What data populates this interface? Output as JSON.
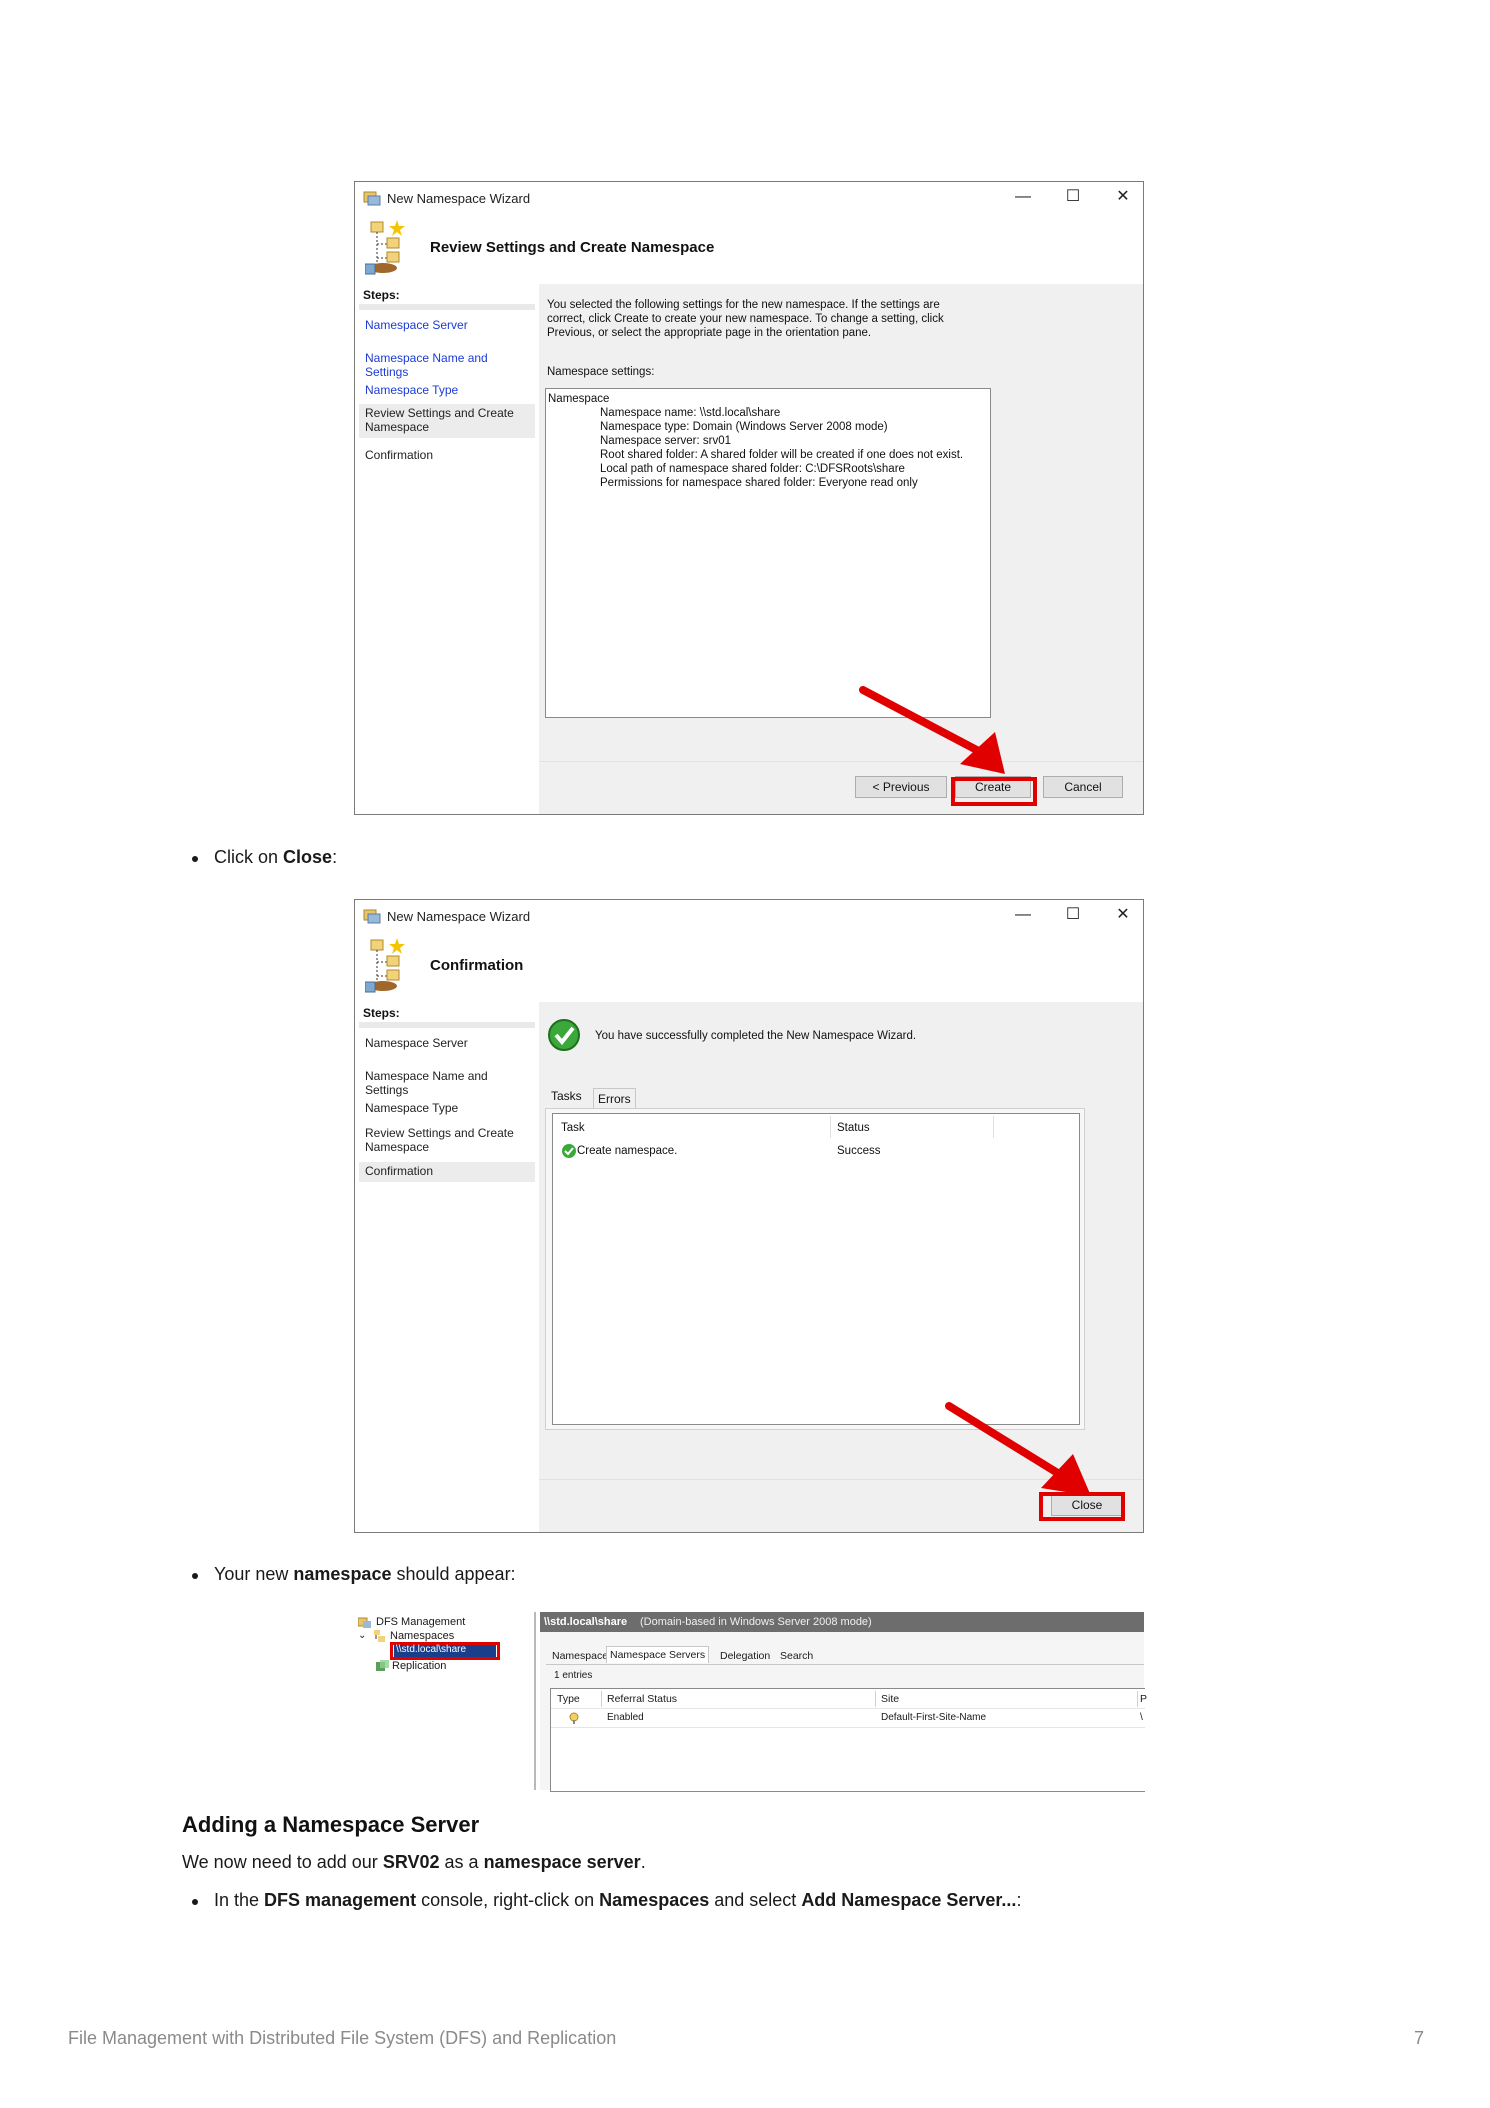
{
  "wizard1": {
    "title": "New Namespace Wizard",
    "header": "Review Settings and Create Namespace",
    "steps_label": "Steps:",
    "steps": [
      "Namespace Server",
      "Namespace Name and Settings",
      "Namespace Type",
      "Review Settings and Create Namespace",
      "Confirmation"
    ],
    "intro": "You selected the following settings for the new namespace. If the settings are correct, click Create to create your new namespace. To change a setting, click Previous, or select the appropriate page in the orientation pane.",
    "settings_label": "Namespace settings:",
    "settings_heading": "Namespace",
    "settings_lines": [
      "Namespace name: \\\\std.local\\share",
      "Namespace type:  Domain (Windows Server 2008 mode)",
      "Namespace server: srv01",
      "Root shared folder:  A shared folder will be created if one does not exist.",
      "Local path of namespace shared folder: C:\\DFSRoots\\share",
      "Permissions for namespace shared folder: Everyone read only"
    ],
    "btn_previous": "< Previous",
    "btn_create": "Create",
    "btn_cancel": "Cancel"
  },
  "bullet1": {
    "pre": "Click on ",
    "bold": "Close",
    "post": ":"
  },
  "wizard2": {
    "title": "New Namespace Wizard",
    "header": "Confirmation",
    "steps_label": "Steps:",
    "steps": [
      "Namespace Server",
      "Namespace Name and Settings",
      "Namespace Type",
      "Review Settings and Create Namespace",
      "Confirmation"
    ],
    "success_msg": "You have successfully completed the New Namespace Wizard.",
    "tabs": [
      "Tasks",
      "Errors"
    ],
    "columns": [
      "Task",
      "Status"
    ],
    "rows": [
      {
        "task": "Create namespace.",
        "status": "Success"
      }
    ],
    "btn_close": "Close"
  },
  "bullet2": {
    "pre": "Your new ",
    "bold": "namespace",
    "post": " should appear:"
  },
  "dfs": {
    "tree": [
      "DFS Management",
      "Namespaces",
      "\\\\std.local\\share",
      "Replication"
    ],
    "panel_title": "\\\\std.local\\share",
    "panel_subtitle": "(Domain-based in Windows Server 2008 mode)",
    "tabs": [
      "Namespace",
      "Namespace Servers",
      "Delegation",
      "Search"
    ],
    "entries": "1 entries",
    "columns": [
      "Type",
      "Referral Status",
      "Site",
      "P"
    ],
    "row": {
      "referral": "Enabled",
      "site": "Default-First-Site-Name",
      "extra": "\\"
    }
  },
  "section": {
    "heading": "Adding a Namespace Server",
    "para": {
      "pre": "We now need to add our ",
      "b1": "SRV02",
      "mid": " as a ",
      "b2": "namespace server",
      "post": "."
    },
    "bullet": {
      "t1": "In the ",
      "b1": "DFS management",
      "t2": " console, right-click on ",
      "b2": "Namespaces",
      "t3": " and select ",
      "b3": "Add Namespace Server...",
      "t4": ":"
    }
  },
  "footer": {
    "title": "File Management with Distributed File System (DFS) and Replication",
    "page": "7"
  },
  "colors": {
    "link": "#1c3bd6",
    "highlight": "#e10000",
    "success": "#2e9b2e"
  }
}
